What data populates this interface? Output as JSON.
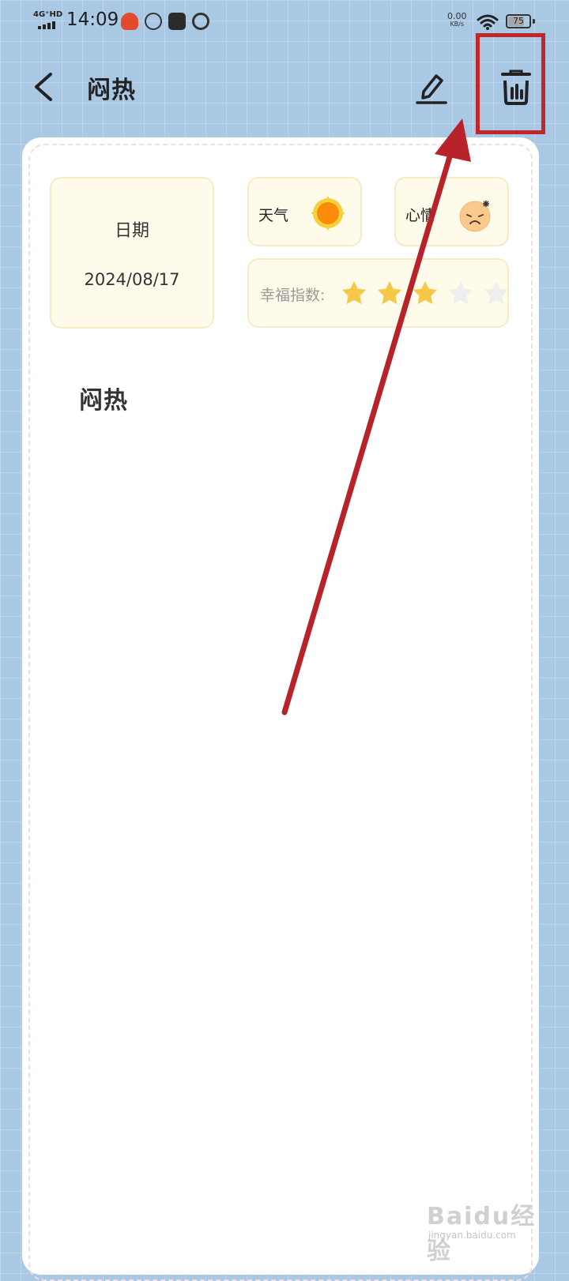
{
  "status_bar": {
    "network": "4G⁺HD",
    "time": "14:09",
    "speed_value": "0.00",
    "speed_unit": "KB/s",
    "battery": "75"
  },
  "header": {
    "title": "闷热",
    "back_icon": "chevron-left-icon",
    "edit_icon": "pencil-icon",
    "delete_icon": "trash-icon"
  },
  "entry": {
    "date_label": "日期",
    "date_value": "2024/08/17",
    "weather_label": "天气",
    "weather_icon": "sun-icon",
    "mood_label": "心情",
    "mood_icon": "sad-face-icon",
    "happiness_label": "幸福指数:",
    "happiness_rating": 3,
    "happiness_max": 5,
    "content": "闷热"
  },
  "annotation": {
    "color": "#c1262a"
  },
  "watermark": {
    "main": "Baidu经验",
    "sub": "jingyan.baidu.com"
  },
  "colors": {
    "background": "#a9c8e4",
    "card": "#ffffff",
    "info_box": "#fffbea",
    "star_filled": "#f5c84a",
    "star_empty": "#eeeeee"
  }
}
